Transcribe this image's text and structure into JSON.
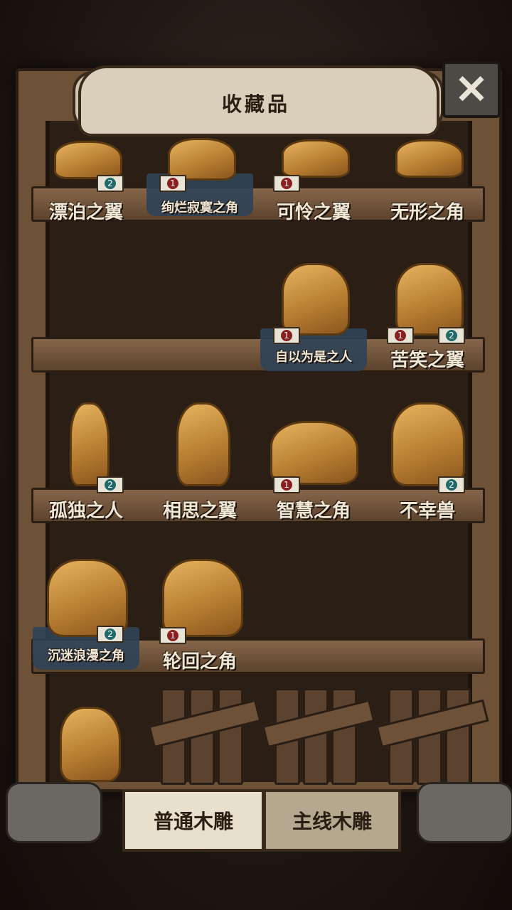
{
  "header": {
    "title": "收藏品"
  },
  "tabs": [
    {
      "label": "普通木雕",
      "active": true
    },
    {
      "label": "主线木雕",
      "active": false
    }
  ],
  "shelves": [
    {
      "items": [
        {
          "name": "漂泊之翼",
          "badges": [
            "2"
          ],
          "badge_colors": [
            "teal"
          ],
          "highlight": false
        },
        {
          "name": "绚烂寂寞之角",
          "badges": [
            "1"
          ],
          "badge_colors": [
            "red"
          ],
          "highlight": true
        },
        {
          "name": "可怜之翼",
          "badges": [
            "1"
          ],
          "badge_colors": [
            "red"
          ],
          "highlight": false
        },
        {
          "name": "无形之角",
          "badges": [],
          "badge_colors": [],
          "highlight": false
        }
      ]
    },
    {
      "items": [
        {
          "name": "自以为是之人",
          "badges": [
            "1"
          ],
          "badge_colors": [
            "red"
          ],
          "highlight": true
        },
        {
          "name": "苦笑之翼",
          "badges": [
            "1",
            "2"
          ],
          "badge_colors": [
            "red",
            "teal"
          ],
          "highlight": false
        }
      ]
    },
    {
      "items": [
        {
          "name": "孤独之人",
          "badges": [
            "2"
          ],
          "badge_colors": [
            "teal"
          ],
          "highlight": false
        },
        {
          "name": "相思之翼",
          "badges": [],
          "badge_colors": [],
          "highlight": false
        },
        {
          "name": "智慧之角",
          "badges": [
            "1"
          ],
          "badge_colors": [
            "red"
          ],
          "highlight": false
        },
        {
          "name": "不幸兽",
          "badges": [
            "2"
          ],
          "badge_colors": [
            "teal"
          ],
          "highlight": false
        }
      ]
    },
    {
      "items": [
        {
          "name": "沉迷浪漫之角",
          "badges": [
            "2"
          ],
          "badge_colors": [
            "teal"
          ],
          "highlight": true
        },
        {
          "name": "轮回之角",
          "badges": [
            "1"
          ],
          "badge_colors": [
            "red"
          ],
          "highlight": false
        }
      ]
    }
  ],
  "colors": {
    "wood": "#6e5238",
    "badge_red": "#8b1e1e",
    "badge_teal": "#1f6b6b",
    "label": "#efe6d4"
  }
}
